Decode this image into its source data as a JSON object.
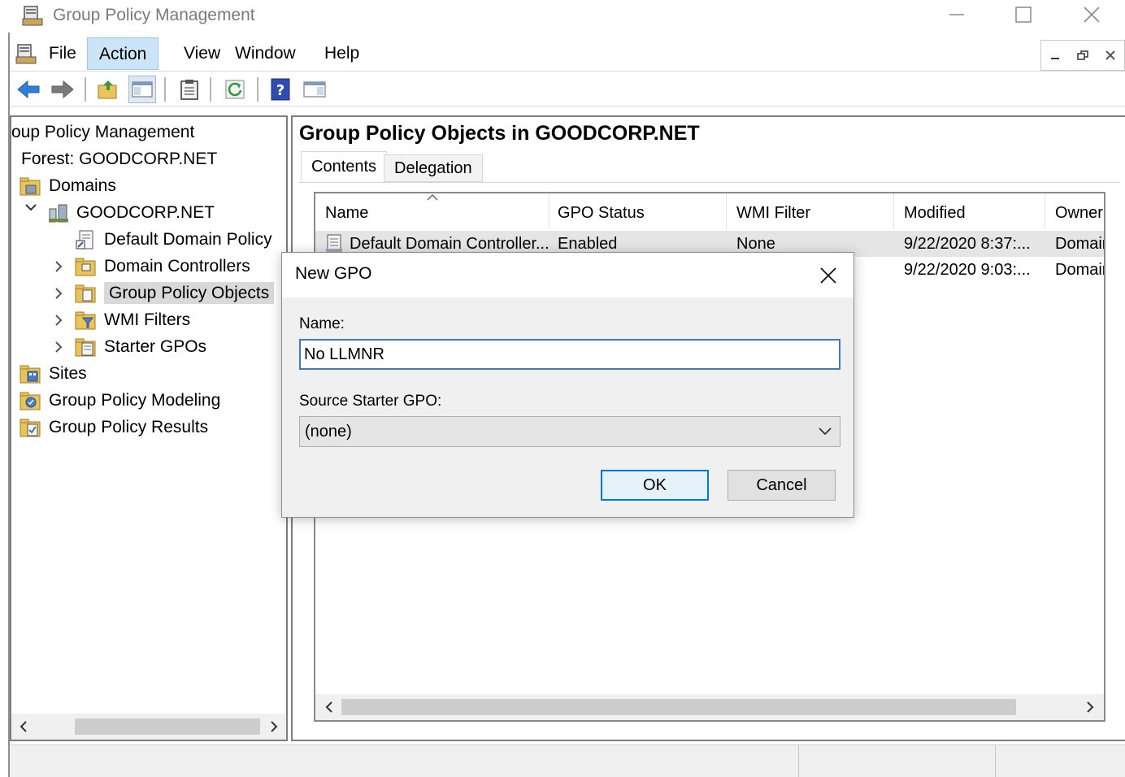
{
  "window": {
    "title": "Group Policy Management"
  },
  "menu": {
    "items": [
      "File",
      "Action",
      "View",
      "Window",
      "Help"
    ],
    "active": "Action"
  },
  "toolbar": {
    "buttons": [
      "back-icon",
      "forward-icon",
      "up-folder-icon",
      "show-hide-tree-icon",
      "clipboard-icon",
      "refresh-icon",
      "help-icon",
      "action-pane-icon"
    ]
  },
  "tree": {
    "root_partial": "oup Policy Management",
    "forest": "Forest: GOODCORP.NET",
    "domains": "Domains",
    "domain": "GOODCORP.NET",
    "default_policy": "Default Domain Policy",
    "domain_controllers": "Domain Controllers",
    "gpo": "Group Policy Objects",
    "wmi": "WMI Filters",
    "starter": "Starter GPOs",
    "sites": "Sites",
    "modeling": "Group Policy Modeling",
    "results": "Group Policy Results",
    "cut_left_char": "g"
  },
  "content": {
    "title": "Group Policy Objects in GOODCORP.NET",
    "tabs": [
      "Contents",
      "Delegation"
    ],
    "columns": [
      "Name",
      "GPO Status",
      "WMI Filter",
      "Modified",
      "Owner"
    ],
    "rows": [
      {
        "name": "Default Domain Controller...",
        "status": "Enabled",
        "wmi": "None",
        "modified": "9/22/2020 8:37:...",
        "owner": "Domair"
      },
      {
        "name": "",
        "status": "",
        "wmi": "",
        "modified": "9/22/2020 9:03:...",
        "owner": "Domair"
      }
    ]
  },
  "dialog": {
    "title": "New GPO",
    "name_label": "Name:",
    "name_value": "No LLMNR",
    "starter_label": "Source Starter GPO:",
    "starter_value": "(none)",
    "ok": "OK",
    "cancel": "Cancel"
  },
  "colors": {
    "accent": "#0078d7",
    "selection": "#cce4f7",
    "focus_border": "#3e79c4"
  }
}
